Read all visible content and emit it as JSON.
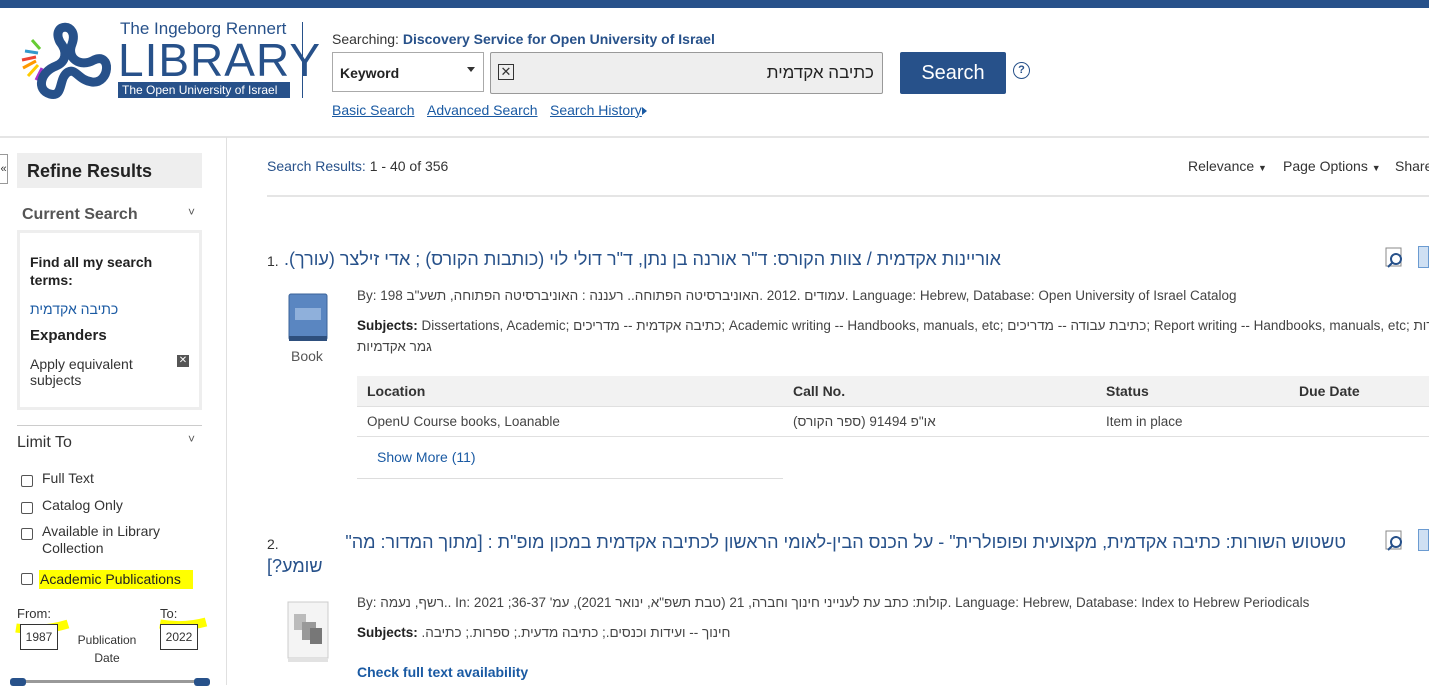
{
  "header": {
    "logo_line1": "The Ingeborg Rennert",
    "logo_line2": "LIBRARY",
    "logo_line3": "The Open University of Israel",
    "searching_label": "Searching:",
    "searching_target": "Discovery Service for Open University of Israel",
    "field_select": "Keyword",
    "query": "כתיבה אקדמית",
    "search_button": "Search",
    "help": "?",
    "links": [
      "Basic Search",
      "Advanced Search",
      "Search History"
    ]
  },
  "sidebar": {
    "collapse": "«",
    "refine_title": "Refine Results",
    "current_search": "Current Search",
    "find_all": "Find all my search terms:",
    "term": "כתיבה אקדמית",
    "expanders": "Expanders",
    "expander_item": "Apply equivalent subjects",
    "limit_to": "Limit To",
    "limits": [
      "Full Text",
      "Catalog Only",
      "Available in Library Collection",
      "Academic Publications"
    ],
    "from_label": "From:",
    "to_label": "To:",
    "from_value": "1987",
    "to_value": "2022",
    "pub_date_label": "Publication Date"
  },
  "toolbar": {
    "results_label": "Search Results:",
    "results_range": "1 - 40 of 356",
    "relevance": "Relevance",
    "page_options": "Page Options",
    "share": "Share"
  },
  "results": [
    {
      "number": "1.",
      "title": "אוריינות אקדמית / צוות הקורס: ד\"ר אורנה בן נתן, ד\"ר דולי לוי (כותבות הקורס) ; אדי זילצר (עורך).",
      "type": "Book",
      "by_line": "By: 198 עמודים .2012 .האוניברסיטה הפתוחה.. רעננה : האוניברסיטה הפתוחה, תשע\"ב. Language: Hebrew, Database: Open University of Israel Catalog",
      "subjects_label": "Subjects:",
      "subjects": "Dissertations, Academic; כתיבה אקדמית -- מדריכים; Academic writing -- Handbooks, manuals, etc; כתיבת עבודה -- מדריכים; Report writing -- Handbooks, manuals, etc; עבודות",
      "subjects_line2": "גמר אקדמיות",
      "table_headers": [
        "Location",
        "Call No.",
        "Status",
        "Due Date"
      ],
      "table_row": [
        "OpenU Course books, Loanable",
        "או\"פ 91494 (ספר הקורס)",
        "Item in place",
        ""
      ],
      "show_more": "Show More (11)"
    },
    {
      "number": "2.",
      "title": "טשטוש השורות: כתיבה אקדמית, מקצועית ופופולרית\" - על הכנס הבין-לאומי הראשון לכתיבה אקדמית במכון מופ\"ת : [מתוך המדור: מה\"",
      "title_line2": "שומע?]",
      "by_line": "By: רשף, נעמה.. In: 2021 ;36-37 'קולות: כתב עת לענייני חינוך וחברה, 21 (טבת תשפ\"א, ינואר 2021), עמ. Language: Hebrew, Database: Index to Hebrew Periodicals",
      "subjects_label": "Subjects:",
      "subjects": "חינוך -- ועידות וכנסים.; כתיבה מדעית.; ספרות.; כתיבה.",
      "full_text_link": "Check full text availability"
    }
  ],
  "colors": {
    "brand": "#27518a",
    "link": "#1a5aa3",
    "highlight": "#ffff00"
  }
}
